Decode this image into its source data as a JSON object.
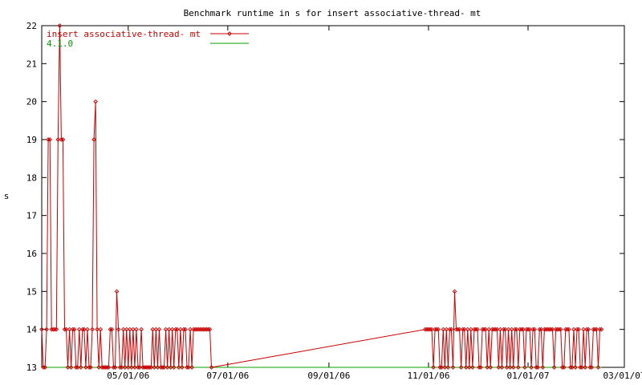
{
  "chart_data": {
    "type": "line",
    "title": "Benchmark runtime in s for insert associative-thread-  mt",
    "xlabel": "",
    "ylabel": "s",
    "ylim": [
      13,
      22
    ],
    "xlim": [
      "2006-03-09",
      "2007-03-01"
    ],
    "yticks": [
      13,
      14,
      15,
      16,
      17,
      18,
      19,
      20,
      21,
      22
    ],
    "xticks": [
      "05/01/06",
      "07/01/06",
      "09/01/06",
      "11/01/06",
      "01/01/07",
      "03/01/07"
    ],
    "xtick_dates": [
      "2006-05-01",
      "2006-07-01",
      "2006-09-01",
      "2006-11-01",
      "2007-01-01",
      "2007-03-01"
    ],
    "legend_position": "top-left",
    "grid": false,
    "series": [
      {
        "name": "insert associative-thread-  mt",
        "color": "#cc0000",
        "marker": "diamond",
        "points": [
          [
            "2006-03-09",
            14
          ],
          [
            "2006-03-10",
            13
          ],
          [
            "2006-03-11",
            13
          ],
          [
            "2006-03-12",
            14
          ],
          [
            "2006-03-13",
            19
          ],
          [
            "2006-03-14",
            19
          ],
          [
            "2006-03-15",
            14
          ],
          [
            "2006-03-16",
            14
          ],
          [
            "2006-03-17",
            14
          ],
          [
            "2006-03-18",
            14
          ],
          [
            "2006-03-19",
            19
          ],
          [
            "2006-03-20",
            22
          ],
          [
            "2006-03-21",
            19
          ],
          [
            "2006-03-22",
            19
          ],
          [
            "2006-03-23",
            14
          ],
          [
            "2006-03-24",
            14
          ],
          [
            "2006-03-25",
            13
          ],
          [
            "2006-03-26",
            14
          ],
          [
            "2006-03-27",
            13
          ],
          [
            "2006-03-28",
            14
          ],
          [
            "2006-03-29",
            14
          ],
          [
            "2006-03-30",
            13
          ],
          [
            "2006-03-31",
            13
          ],
          [
            "2006-04-01",
            14
          ],
          [
            "2006-04-02",
            13
          ],
          [
            "2006-04-03",
            14
          ],
          [
            "2006-04-04",
            14
          ],
          [
            "2006-04-05",
            13
          ],
          [
            "2006-04-06",
            14
          ],
          [
            "2006-04-07",
            13
          ],
          [
            "2006-04-08",
            13
          ],
          [
            "2006-04-09",
            14
          ],
          [
            "2006-04-10",
            19
          ],
          [
            "2006-04-11",
            20
          ],
          [
            "2006-04-12",
            14
          ],
          [
            "2006-04-13",
            13
          ],
          [
            "2006-04-14",
            14
          ],
          [
            "2006-04-15",
            13
          ],
          [
            "2006-04-16",
            13
          ],
          [
            "2006-04-17",
            13
          ],
          [
            "2006-04-18",
            13
          ],
          [
            "2006-04-19",
            13
          ],
          [
            "2006-04-20",
            14
          ],
          [
            "2006-04-21",
            14
          ],
          [
            "2006-04-22",
            13
          ],
          [
            "2006-04-23",
            13
          ],
          [
            "2006-04-24",
            15
          ],
          [
            "2006-04-25",
            14
          ],
          [
            "2006-04-26",
            13
          ],
          [
            "2006-04-27",
            13
          ],
          [
            "2006-04-28",
            14
          ],
          [
            "2006-04-29",
            13
          ],
          [
            "2006-04-30",
            14
          ],
          [
            "2006-05-01",
            13
          ],
          [
            "2006-05-02",
            14
          ],
          [
            "2006-05-03",
            13
          ],
          [
            "2006-05-04",
            14
          ],
          [
            "2006-05-05",
            13
          ],
          [
            "2006-05-06",
            14
          ],
          [
            "2006-05-07",
            13
          ],
          [
            "2006-05-08",
            13
          ],
          [
            "2006-05-09",
            14
          ],
          [
            "2006-05-10",
            13
          ],
          [
            "2006-05-11",
            13
          ],
          [
            "2006-05-12",
            13
          ],
          [
            "2006-05-13",
            13
          ],
          [
            "2006-05-14",
            13
          ],
          [
            "2006-05-15",
            13
          ],
          [
            "2006-05-16",
            14
          ],
          [
            "2006-05-17",
            13
          ],
          [
            "2006-05-18",
            14
          ],
          [
            "2006-05-19",
            13
          ],
          [
            "2006-05-20",
            14
          ],
          [
            "2006-05-21",
            13
          ],
          [
            "2006-05-22",
            13
          ],
          [
            "2006-05-23",
            13
          ],
          [
            "2006-05-24",
            14
          ],
          [
            "2006-05-25",
            13
          ],
          [
            "2006-05-26",
            14
          ],
          [
            "2006-05-27",
            13
          ],
          [
            "2006-05-28",
            14
          ],
          [
            "2006-05-29",
            13
          ],
          [
            "2006-05-30",
            14
          ],
          [
            "2006-05-31",
            14
          ],
          [
            "2006-06-01",
            13
          ],
          [
            "2006-06-02",
            14
          ],
          [
            "2006-06-03",
            13
          ],
          [
            "2006-06-04",
            14
          ],
          [
            "2006-06-05",
            14
          ],
          [
            "2006-06-06",
            13
          ],
          [
            "2006-06-07",
            13
          ],
          [
            "2006-06-08",
            14
          ],
          [
            "2006-06-09",
            13
          ],
          [
            "2006-06-10",
            14
          ],
          [
            "2006-06-11",
            14
          ],
          [
            "2006-06-12",
            14
          ],
          [
            "2006-06-13",
            14
          ],
          [
            "2006-06-14",
            14
          ],
          [
            "2006-06-15",
            14
          ],
          [
            "2006-06-16",
            14
          ],
          [
            "2006-06-17",
            14
          ],
          [
            "2006-06-18",
            14
          ],
          [
            "2006-06-19",
            14
          ],
          [
            "2006-06-20",
            14
          ],
          [
            "2006-06-21",
            13
          ],
          [
            "2006-10-30",
            14
          ],
          [
            "2006-10-31",
            14
          ],
          [
            "2006-11-01",
            14
          ],
          [
            "2006-11-02",
            14
          ],
          [
            "2006-11-03",
            14
          ],
          [
            "2006-11-04",
            13
          ],
          [
            "2006-11-05",
            14
          ],
          [
            "2006-11-06",
            14
          ],
          [
            "2006-11-07",
            14
          ],
          [
            "2006-11-08",
            13
          ],
          [
            "2006-11-09",
            13
          ],
          [
            "2006-11-10",
            14
          ],
          [
            "2006-11-11",
            13
          ],
          [
            "2006-11-12",
            14
          ],
          [
            "2006-11-13",
            13
          ],
          [
            "2006-11-14",
            14
          ],
          [
            "2006-11-15",
            14
          ],
          [
            "2006-11-16",
            13
          ],
          [
            "2006-11-17",
            15
          ],
          [
            "2006-11-18",
            14
          ],
          [
            "2006-11-19",
            14
          ],
          [
            "2006-11-20",
            14
          ],
          [
            "2006-11-21",
            13
          ],
          [
            "2006-11-22",
            14
          ],
          [
            "2006-11-23",
            14
          ],
          [
            "2006-11-24",
            13
          ],
          [
            "2006-11-25",
            14
          ],
          [
            "2006-11-26",
            13
          ],
          [
            "2006-11-27",
            14
          ],
          [
            "2006-11-28",
            13
          ],
          [
            "2006-11-29",
            14
          ],
          [
            "2006-11-30",
            14
          ],
          [
            "2006-12-01",
            14
          ],
          [
            "2006-12-02",
            13
          ],
          [
            "2006-12-03",
            13
          ],
          [
            "2006-12-04",
            14
          ],
          [
            "2006-12-05",
            14
          ],
          [
            "2006-12-06",
            14
          ],
          [
            "2006-12-07",
            13
          ],
          [
            "2006-12-08",
            14
          ],
          [
            "2006-12-09",
            13
          ],
          [
            "2006-12-10",
            14
          ],
          [
            "2006-12-11",
            14
          ],
          [
            "2006-12-12",
            14
          ],
          [
            "2006-12-13",
            14
          ],
          [
            "2006-12-14",
            13
          ],
          [
            "2006-12-15",
            14
          ],
          [
            "2006-12-16",
            13
          ],
          [
            "2006-12-17",
            14
          ],
          [
            "2006-12-18",
            14
          ],
          [
            "2006-12-19",
            13
          ],
          [
            "2006-12-20",
            14
          ],
          [
            "2006-12-21",
            13
          ],
          [
            "2006-12-22",
            14
          ],
          [
            "2006-12-23",
            13
          ],
          [
            "2006-12-24",
            14
          ],
          [
            "2006-12-25",
            14
          ],
          [
            "2006-12-26",
            13
          ],
          [
            "2006-12-27",
            14
          ],
          [
            "2006-12-28",
            14
          ],
          [
            "2006-12-29",
            14
          ],
          [
            "2006-12-30",
            13
          ],
          [
            "2006-12-31",
            14
          ],
          [
            "2007-01-01",
            14
          ],
          [
            "2007-01-02",
            14
          ],
          [
            "2007-01-03",
            13
          ],
          [
            "2007-01-04",
            14
          ],
          [
            "2007-01-05",
            14
          ],
          [
            "2007-01-06",
            13
          ],
          [
            "2007-01-07",
            13
          ],
          [
            "2007-01-08",
            14
          ],
          [
            "2007-01-09",
            14
          ],
          [
            "2007-01-10",
            13
          ],
          [
            "2007-01-11",
            14
          ],
          [
            "2007-01-12",
            14
          ],
          [
            "2007-01-13",
            14
          ],
          [
            "2007-01-14",
            14
          ],
          [
            "2007-01-15",
            14
          ],
          [
            "2007-01-16",
            14
          ],
          [
            "2007-01-17",
            13
          ],
          [
            "2007-01-18",
            14
          ],
          [
            "2007-01-19",
            14
          ],
          [
            "2007-01-20",
            14
          ],
          [
            "2007-01-21",
            14
          ],
          [
            "2007-01-22",
            13
          ],
          [
            "2007-01-23",
            13
          ],
          [
            "2007-01-24",
            14
          ],
          [
            "2007-01-25",
            14
          ],
          [
            "2007-01-26",
            14
          ],
          [
            "2007-01-27",
            13
          ],
          [
            "2007-01-28",
            13
          ],
          [
            "2007-01-29",
            14
          ],
          [
            "2007-01-30",
            13
          ],
          [
            "2007-01-31",
            14
          ],
          [
            "2007-02-01",
            14
          ],
          [
            "2007-02-02",
            13
          ],
          [
            "2007-02-03",
            13
          ],
          [
            "2007-02-04",
            14
          ],
          [
            "2007-02-05",
            13
          ],
          [
            "2007-02-06",
            14
          ],
          [
            "2007-02-07",
            14
          ],
          [
            "2007-02-08",
            13
          ],
          [
            "2007-02-09",
            13
          ],
          [
            "2007-02-10",
            14
          ],
          [
            "2007-02-11",
            14
          ],
          [
            "2007-02-12",
            14
          ],
          [
            "2007-02-13",
            13
          ],
          [
            "2007-02-14",
            14
          ],
          [
            "2007-02-15",
            14
          ]
        ]
      },
      {
        "name": "4.1.0",
        "color": "#00a000",
        "marker": "none",
        "points": [
          [
            "2006-03-09",
            13
          ],
          [
            "2007-02-15",
            13
          ]
        ]
      }
    ]
  }
}
